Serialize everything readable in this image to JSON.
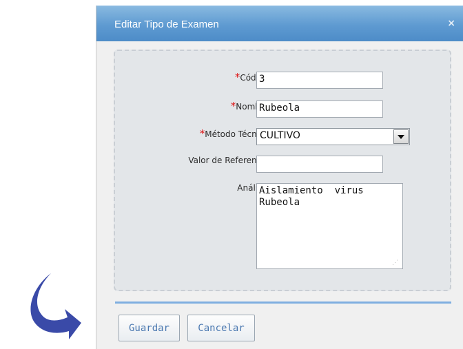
{
  "dialog": {
    "title": "Editar Tipo de Examen",
    "close_glyph": "×"
  },
  "form": {
    "required_marker": "*",
    "codigo": {
      "label": "Código:",
      "value": "3"
    },
    "nombre": {
      "label": "Nombre:",
      "value": "Rubeola"
    },
    "metodo": {
      "label": "Método Técnica:",
      "value": "CULTIVO"
    },
    "valor_referencia": {
      "label": "Valor de Referencia:",
      "value": ""
    },
    "analisis": {
      "label": "Análisis:",
      "value": "Aislamiento  virus\nRubeola"
    }
  },
  "buttons": {
    "save_label": "Guardar",
    "cancel_label": "Cancelar"
  },
  "icons": {
    "arrow": "curved-arrow-icon",
    "close": "close-icon",
    "dropdown": "chevron-down-icon",
    "resize": "resize-grip-icon"
  },
  "colors": {
    "title_bar": "#5e9ad1",
    "arrow": "#3a4aa8",
    "required": "#dd1111",
    "button_text": "#4a78b0",
    "divider": "#7eaee0"
  }
}
